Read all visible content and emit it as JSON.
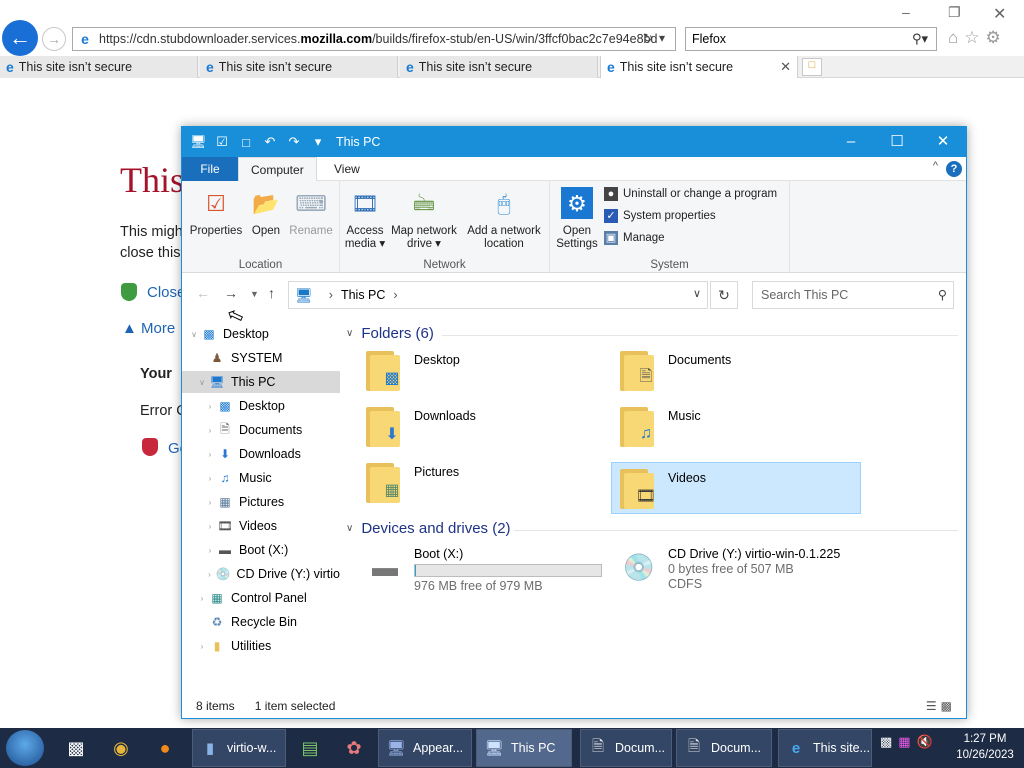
{
  "browser": {
    "url_prefix": "https://cdn.stubdownloader.services.",
    "url_domain": "mozilla.com",
    "url_suffix": "/builds/firefox-stub/en-US/win/3ffcf0bac2c7e94e8bd",
    "search_value": "Flefox",
    "tabs": [
      {
        "label": "This site isn’t secure"
      },
      {
        "label": "This site isn’t secure"
      },
      {
        "label": "This site isn’t secure"
      },
      {
        "label": "This site isn’t secure"
      }
    ]
  },
  "background_page": {
    "title_fragment": "This",
    "line1": "This migh",
    "line2": "close this",
    "link_close": "Close",
    "link_more": "More",
    "your_fragment": "Your",
    "error_fragment": "Error C",
    "go_fragment": "Go"
  },
  "explorer": {
    "title": "This PC",
    "ribbon_tabs": {
      "file": "File",
      "computer": "Computer",
      "view": "View"
    },
    "ribbon": {
      "location": {
        "label": "Location",
        "properties": "Properties",
        "open": "Open",
        "rename": "Rename"
      },
      "network": {
        "label": "Network",
        "access_media_1": "Access",
        "access_media_2": "media ▾",
        "map_drive_1": "Map network",
        "map_drive_2": "drive ▾",
        "add_location_1": "Add a network",
        "add_location_2": "location"
      },
      "system": {
        "label": "System",
        "open_settings_1": "Open",
        "open_settings_2": "Settings",
        "uninstall": "Uninstall or change a program",
        "system_properties": "System properties",
        "manage": "Manage"
      }
    },
    "breadcrumb": "This PC",
    "search_placeholder": "Search This PC",
    "nav_pane": [
      {
        "label": "Desktop"
      },
      {
        "label": "SYSTEM"
      },
      {
        "label": "This PC"
      },
      {
        "label": "Desktop"
      },
      {
        "label": "Documents"
      },
      {
        "label": "Downloads"
      },
      {
        "label": "Music"
      },
      {
        "label": "Pictures"
      },
      {
        "label": "Videos"
      },
      {
        "label": "Boot (X:)"
      },
      {
        "label": "CD Drive (Y:) virtio"
      },
      {
        "label": "Control Panel"
      },
      {
        "label": "Recycle Bin"
      },
      {
        "label": "Utilities"
      }
    ],
    "folders_header": "Folders (6)",
    "folders": [
      {
        "label": "Desktop"
      },
      {
        "label": "Documents"
      },
      {
        "label": "Downloads"
      },
      {
        "label": "Music"
      },
      {
        "label": "Pictures"
      },
      {
        "label": "Videos"
      }
    ],
    "devices_header": "Devices and drives (2)",
    "drives": [
      {
        "name": "Boot (X:)",
        "free": "976 MB free of 979 MB",
        "used_fraction": 0.003
      },
      {
        "name": "CD Drive (Y:) virtio-win-0.1.225",
        "free": "0 bytes free of 507 MB",
        "fs": "CDFS"
      }
    ],
    "status_items": "8 items",
    "status_selected": "1 item selected"
  },
  "taskbar": {
    "buttons": [
      {
        "label": "virtio-w..."
      },
      {
        "label": "Appear..."
      },
      {
        "label": "This PC"
      },
      {
        "label": "Docum..."
      },
      {
        "label": "Docum..."
      },
      {
        "label": "This site..."
      }
    ],
    "time": "1:27 PM",
    "date": "10/26/2023"
  },
  "colors": {
    "explorer_accent": "#1a8fd9",
    "selection": "#cce8ff",
    "folder_header": "#1e3287",
    "taskbar": "#1d2b44",
    "warning_title": "#a4132a"
  }
}
